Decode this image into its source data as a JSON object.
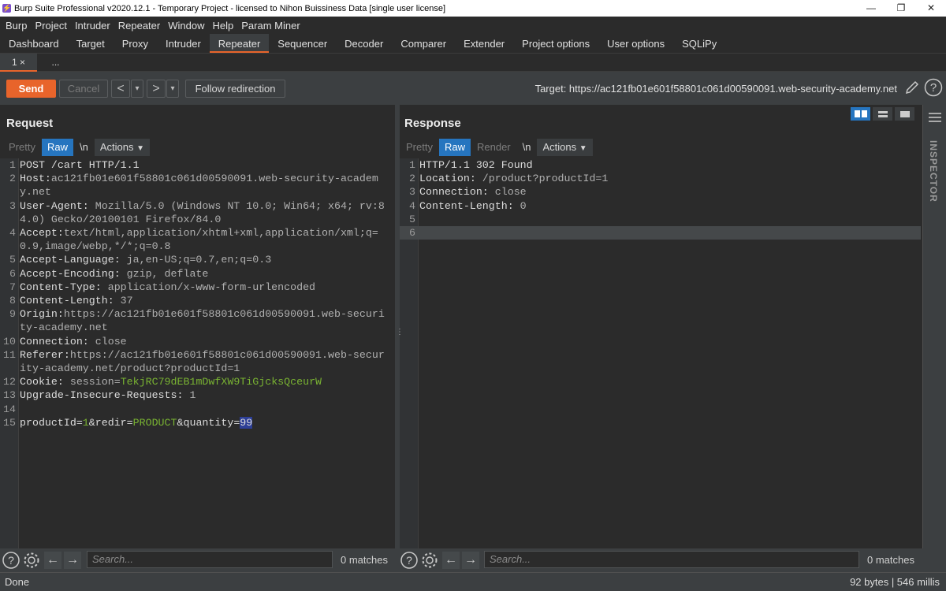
{
  "window": {
    "title": "Burp Suite Professional v2020.12.1 - Temporary Project - licensed to Nihon Buissiness Data [single user license]",
    "controls": [
      "—",
      "❐",
      "✕"
    ]
  },
  "menu": [
    "Burp",
    "Project",
    "Intruder",
    "Repeater",
    "Window",
    "Help",
    "Param Miner"
  ],
  "tabs": [
    "Dashboard",
    "Target",
    "Proxy",
    "Intruder",
    "Repeater",
    "Sequencer",
    "Decoder",
    "Comparer",
    "Extender",
    "Project options",
    "User options",
    "SQLiPy"
  ],
  "active_tab": "Repeater",
  "subtabs": [
    {
      "label": "1 ×"
    },
    {
      "label": "..."
    }
  ],
  "toolbar": {
    "send": "Send",
    "cancel": "Cancel",
    "back": "<",
    "forward": ">",
    "dropdown": "▾",
    "follow": "Follow redirection",
    "target": "Target: https://ac121fb01e601f58801c061d00590091.web-security-academy.net"
  },
  "request": {
    "title": "Request",
    "tabs": [
      "Pretty",
      "Raw",
      "\\n",
      "Actions"
    ],
    "lines": [
      {
        "n": "1",
        "k": "POST /cart HTTP/1.1",
        "v": ""
      },
      {
        "n": "2",
        "k": "Host:",
        "v": "ac121fb01e601f58801c061d00590091.web-security-academy.net"
      },
      {
        "n": "3",
        "k": "User-Agent:",
        "v": " Mozilla/5.0 (Windows NT 10.0; Win64; x64; rv:84.0) Gecko/20100101 Firefox/84.0"
      },
      {
        "n": "4",
        "k": "Accept:",
        "v": "text/html,application/xhtml+xml,application/xml;q=0.9,image/webp,*/*;q=0.8"
      },
      {
        "n": "5",
        "k": "Accept-Language:",
        "v": " ja,en-US;q=0.7,en;q=0.3"
      },
      {
        "n": "6",
        "k": "Accept-Encoding:",
        "v": " gzip, deflate"
      },
      {
        "n": "7",
        "k": "Content-Type:",
        "v": " application/x-www-form-urlencoded"
      },
      {
        "n": "8",
        "k": "Content-Length:",
        "v": " 37"
      },
      {
        "n": "9",
        "k": "Origin:",
        "v": "https://ac121fb01e601f58801c061d00590091.web-security-academy.net"
      },
      {
        "n": "10",
        "k": "Connection:",
        "v": " close"
      },
      {
        "n": "11",
        "k": "Referer:",
        "v": "https://ac121fb01e601f58801c061d00590091.web-security-academy.net/product?productId=1"
      },
      {
        "n": "12",
        "k": "Cookie:",
        "v": " session=",
        "g": "TekjRC79dEB1mDwfXW9TiGjcksQceurW"
      },
      {
        "n": "13",
        "k": "Upgrade-Insecure-Requests:",
        "v": " 1"
      },
      {
        "n": "14",
        "k": "",
        "v": ""
      },
      {
        "n": "15",
        "body": true,
        "p1": "productId=",
        "g1": "1",
        "p2": "&redir=",
        "g2": "PRODUCT",
        "p3": "&quantity=",
        "sel": "99"
      }
    ],
    "search_placeholder": "Search...",
    "matches": "0 matches"
  },
  "response": {
    "title": "Response",
    "tabs": [
      "Pretty",
      "Raw",
      "Render",
      "\\n",
      "Actions"
    ],
    "lines": [
      {
        "n": "1",
        "k": "HTTP/1.1 302 Found",
        "v": ""
      },
      {
        "n": "2",
        "k": "Location:",
        "v": " /product?productId=1"
      },
      {
        "n": "3",
        "k": "Connection:",
        "v": " close"
      },
      {
        "n": "4",
        "k": "Content-Length:",
        "v": " 0"
      },
      {
        "n": "5",
        "k": "",
        "v": ""
      },
      {
        "n": "6",
        "k": "",
        "v": "",
        "current": true
      }
    ],
    "search_placeholder": "Search...",
    "matches": "0 matches"
  },
  "inspector": "INSPECTOR",
  "status": {
    "left": "Done",
    "right": "92 bytes | 546 millis"
  },
  "colors": {
    "accent": "#e8642b",
    "selected_tab": "#2675bf",
    "value_green": "#79b332",
    "selection": "#2d3f97"
  }
}
